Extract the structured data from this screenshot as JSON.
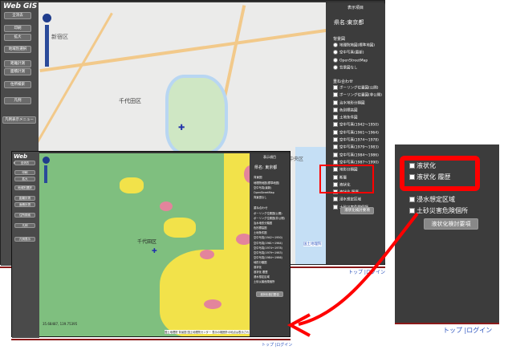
{
  "back": {
    "title": "Web GIS",
    "buttons": [
      "全消去",
      "印刷",
      "拡大",
      "地域別選択",
      "距離計測",
      "面積計測",
      "住所検索",
      "凡例",
      "凡例表示メニュー"
    ],
    "map_labels": [
      "新宿区",
      "千代田区",
      "中央区"
    ],
    "attribution": "国土地理院",
    "panel": {
      "header": "表示項目",
      "pref": "県名:東京都",
      "base_title": "背景図",
      "base_options": [
        "地理院地図(標準地図)",
        "空中写真(最新)",
        "OpenStreetMap",
        "背景図なし"
      ],
      "overlay_title": "重ね合わせ",
      "layers": [
        "ボーリング位置図(公開)",
        "ボーリング位置図(非公開)",
        "治水地形分類図",
        "色別標高図",
        "土地条件図",
        "空中写真(1942〜1950)",
        "空中写真(1961〜1964)",
        "空中写真(1974〜1978)",
        "空中写真(1979〜1983)",
        "空中写真(1984〜1986)",
        "空中写真(1987〜1990)",
        "地形分類図",
        "断層",
        "液状化",
        "液状化 履歴",
        "浸水想定区域",
        "土砂災害危険個所"
      ],
      "action": "液状化検討要項"
    },
    "footer": [
      "トップ",
      "ログイン"
    ]
  },
  "front": {
    "title": "Web GIS",
    "buttons": [
      "全消去",
      "印刷",
      "拡大",
      "地域別選択",
      "距離計測",
      "面積計測",
      "住所検索",
      "凡例",
      "凡例表示"
    ],
    "map_label": "千代田区",
    "coords": "35.68487, 139.75395",
    "attribution": "国土地理院 背景図  国土地理院センター  表示の範囲外の地点は表示されません",
    "panel": {
      "header": "表示項目",
      "pref": "県名: 東京都",
      "base_title": "背景図",
      "base_options": [
        "地理院地図(標準地図)",
        "空中写真(最新)",
        "OpenStreetMap",
        "背景図なし"
      ],
      "overlay_title": "重ね合わせ",
      "layers": [
        "ボーリング位置図(公開)",
        "ボーリング位置図(非公開)",
        "治水地形分類図",
        "色別標高図",
        "土地条件図",
        "空中写真(1942〜1950)",
        "空中写真(1961〜1964)",
        "空中写真(1974〜1978)",
        "空中写真(1979〜1983)",
        "空中写真(1984〜1986)",
        "地形分類図",
        "液状化",
        "液状化 履歴",
        "浸水想定区域",
        "土砂災害危険個所"
      ],
      "action": "液状化検討要項"
    },
    "footer": [
      "トップ",
      "ログイン"
    ]
  },
  "zoom": {
    "items": [
      "液状化",
      "液状化 履歴",
      "浸水想定区域",
      "土砂災害危険個所"
    ],
    "action": "液状化検討要項",
    "footer": [
      "トップ",
      "ログイン"
    ]
  },
  "colors": {
    "highlight": "#ff0000",
    "liq_green": "#7fbf7f",
    "liq_yellow": "#f2e24a",
    "liq_pink": "#e3849c",
    "panel": "#3c3c3c",
    "sidebar": "#4a4a4a"
  }
}
